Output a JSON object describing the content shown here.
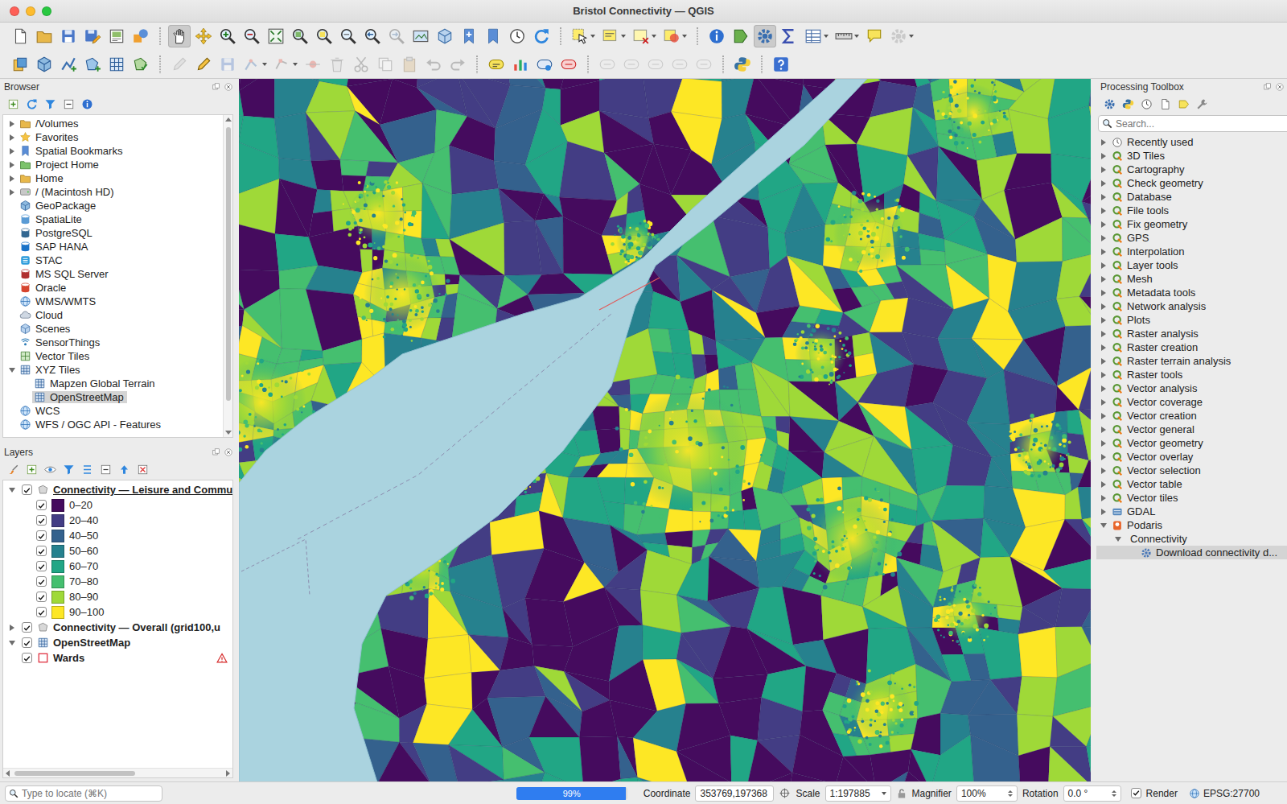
{
  "window": {
    "title": "Bristol Connectivity — QGIS"
  },
  "toolbars": [
    [
      {
        "kind": "button",
        "pressed": false,
        "disabled": false
      },
      {
        "kind": "button",
        "pressed": false,
        "disabled": false
      },
      {
        "kind": "button",
        "pressed": false,
        "disabled": false
      },
      {
        "kind": "button",
        "pressed": false,
        "disabled": false
      },
      {
        "kind": "button",
        "pressed": false,
        "disabled": false
      },
      {
        "kind": "button",
        "pressed": false,
        "disabled": false
      },
      {
        "kind": "separator"
      },
      {
        "kind": "button",
        "pressed": true,
        "disabled": false
      },
      {
        "kind": "button",
        "pressed": false,
        "disabled": false
      },
      {
        "kind": "button",
        "pressed": false,
        "disabled": false
      },
      {
        "kind": "button",
        "pressed": false,
        "disabled": false
      },
      {
        "kind": "button",
        "pressed": false,
        "disabled": false
      },
      {
        "kind": "button",
        "pressed": false,
        "disabled": false
      },
      {
        "kind": "button",
        "pressed": false,
        "disabled": false
      },
      {
        "kind": "button",
        "pressed": false,
        "disabled": false
      },
      {
        "kind": "button",
        "pressed": false,
        "disabled": false
      },
      {
        "kind": "button",
        "pressed": false,
        "disabled": true
      },
      {
        "kind": "button",
        "pressed": false,
        "disabled": false
      },
      {
        "kind": "button",
        "pressed": false,
        "disabled": false
      },
      {
        "kind": "button",
        "pressed": false,
        "disabled": false
      },
      {
        "kind": "button",
        "pressed": false,
        "disabled": false
      },
      {
        "kind": "button",
        "pressed": false,
        "disabled": false
      },
      {
        "kind": "button",
        "pressed": false,
        "disabled": false
      },
      {
        "kind": "separator"
      },
      {
        "kind": "menu",
        "pressed": false,
        "disabled": false
      },
      {
        "kind": "menu",
        "pressed": false,
        "disabled": false
      },
      {
        "kind": "menu",
        "pressed": false,
        "disabled": false
      },
      {
        "kind": "menu",
        "pressed": false,
        "disabled": false
      },
      {
        "kind": "separator"
      },
      {
        "kind": "button",
        "pressed": false,
        "disabled": false
      },
      {
        "kind": "button",
        "pressed": false,
        "disabled": false
      },
      {
        "kind": "button",
        "pressed": true,
        "disabled": false
      },
      {
        "kind": "button",
        "pressed": false,
        "disabled": false
      },
      {
        "kind": "menu",
        "pressed": false,
        "disabled": false
      },
      {
        "kind": "menu",
        "pressed": false,
        "disabled": false
      },
      {
        "kind": "button",
        "pressed": false,
        "disabled": false
      },
      {
        "kind": "menu",
        "pressed": false,
        "disabled": true
      }
    ],
    [
      {
        "kind": "button",
        "pressed": false,
        "disabled": false
      },
      {
        "kind": "button",
        "pressed": false,
        "disabled": false
      },
      {
        "kind": "button",
        "pressed": false,
        "disabled": false
      },
      {
        "kind": "button",
        "pressed": false,
        "disabled": false
      },
      {
        "kind": "button",
        "pressed": false,
        "disabled": false
      },
      {
        "kind": "button",
        "pressed": false,
        "disabled": false
      },
      {
        "kind": "separator"
      },
      {
        "kind": "button",
        "pressed": false,
        "disabled": true
      },
      {
        "kind": "button",
        "pressed": false,
        "disabled": false
      },
      {
        "kind": "button",
        "pressed": false,
        "disabled": true
      },
      {
        "kind": "menu",
        "pressed": false,
        "disabled": true
      },
      {
        "kind": "menu",
        "pressed": false,
        "disabled": true
      },
      {
        "kind": "button",
        "pressed": false,
        "disabled": true
      },
      {
        "kind": "button",
        "pressed": false,
        "disabled": true
      },
      {
        "kind": "button",
        "pressed": false,
        "disabled": true
      },
      {
        "kind": "button",
        "pressed": false,
        "disabled": true
      },
      {
        "kind": "button",
        "pressed": false,
        "disabled": true
      },
      {
        "kind": "button",
        "pressed": false,
        "disabled": true
      },
      {
        "kind": "button",
        "pressed": false,
        "disabled": true
      },
      {
        "kind": "separator"
      },
      {
        "kind": "button",
        "pressed": false,
        "disabled": false
      },
      {
        "kind": "button",
        "pressed": false,
        "disabled": false
      },
      {
        "kind": "button",
        "pressed": false,
        "disabled": false
      },
      {
        "kind": "button",
        "pressed": false,
        "disabled": false
      },
      {
        "kind": "separator"
      },
      {
        "kind": "button",
        "pressed": false,
        "disabled": true
      },
      {
        "kind": "button",
        "pressed": false,
        "disabled": true
      },
      {
        "kind": "button",
        "pressed": false,
        "disabled": true
      },
      {
        "kind": "button",
        "pressed": false,
        "disabled": true
      },
      {
        "kind": "button",
        "pressed": false,
        "disabled": true
      },
      {
        "kind": "separator"
      },
      {
        "kind": "button",
        "pressed": false,
        "disabled": false
      },
      {
        "kind": "separator"
      },
      {
        "kind": "button",
        "pressed": false,
        "disabled": false
      }
    ]
  ],
  "browser": {
    "title": "Browser",
    "items": [
      {
        "label": "/Volumes",
        "depth": 0,
        "expandable": true,
        "expanded": false,
        "selected": false
      },
      {
        "label": "Favorites",
        "depth": 0,
        "expandable": true,
        "expanded": false,
        "selected": false
      },
      {
        "label": "Spatial Bookmarks",
        "depth": 0,
        "expandable": true,
        "expanded": false,
        "selected": false
      },
      {
        "label": "Project Home",
        "depth": 0,
        "expandable": true,
        "expanded": false,
        "selected": false
      },
      {
        "label": "Home",
        "depth": 0,
        "expandable": true,
        "expanded": false,
        "selected": false
      },
      {
        "label": "/ (Macintosh HD)",
        "depth": 0,
        "expandable": true,
        "expanded": false,
        "selected": false
      },
      {
        "label": "GeoPackage",
        "depth": 0,
        "expandable": false,
        "expanded": false,
        "selected": false
      },
      {
        "label": "SpatiaLite",
        "depth": 0,
        "expandable": false,
        "expanded": false,
        "selected": false
      },
      {
        "label": "PostgreSQL",
        "depth": 0,
        "expandable": false,
        "expanded": false,
        "selected": false
      },
      {
        "label": "SAP HANA",
        "depth": 0,
        "expandable": false,
        "expanded": false,
        "selected": false
      },
      {
        "label": "STAC",
        "depth": 0,
        "expandable": false,
        "expanded": false,
        "selected": false
      },
      {
        "label": "MS SQL Server",
        "depth": 0,
        "expandable": false,
        "expanded": false,
        "selected": false
      },
      {
        "label": "Oracle",
        "depth": 0,
        "expandable": false,
        "expanded": false,
        "selected": false
      },
      {
        "label": "WMS/WMTS",
        "depth": 0,
        "expandable": false,
        "expanded": false,
        "selected": false
      },
      {
        "label": "Cloud",
        "depth": 0,
        "expandable": false,
        "expanded": false,
        "selected": false
      },
      {
        "label": "Scenes",
        "depth": 0,
        "expandable": false,
        "expanded": false,
        "selected": false
      },
      {
        "label": "SensorThings",
        "depth": 0,
        "expandable": false,
        "expanded": false,
        "selected": false
      },
      {
        "label": "Vector Tiles",
        "depth": 0,
        "expandable": false,
        "expanded": false,
        "selected": false
      },
      {
        "label": "XYZ Tiles",
        "depth": 0,
        "expandable": true,
        "expanded": true,
        "selected": false
      },
      {
        "label": "Mapzen Global Terrain",
        "depth": 1,
        "expandable": false,
        "expanded": false,
        "selected": false
      },
      {
        "label": "OpenStreetMap",
        "depth": 1,
        "expandable": false,
        "expanded": false,
        "selected": true
      },
      {
        "label": "WCS",
        "depth": 0,
        "expandable": false,
        "expanded": false,
        "selected": false
      },
      {
        "label": "WFS / OGC API - Features",
        "depth": 0,
        "expandable": false,
        "expanded": false,
        "selected": false
      }
    ]
  },
  "layers": {
    "title": "Layers",
    "items": [
      {
        "label": "Connectivity — Leisure and Commu",
        "kind": "vector",
        "expandable": true,
        "expanded": true,
        "checked": true,
        "current": true,
        "warning": false,
        "classes": [
          {
            "label": "0–20",
            "checked": true,
            "color": "#450b5e"
          },
          {
            "label": "20–40",
            "checked": true,
            "color": "#433d84"
          },
          {
            "label": "40–50",
            "checked": true,
            "color": "#34618d"
          },
          {
            "label": "50–60",
            "checked": true,
            "color": "#26818e"
          },
          {
            "label": "60–70",
            "checked": true,
            "color": "#21a685"
          },
          {
            "label": "70–80",
            "checked": true,
            "color": "#45bf6f"
          },
          {
            "label": "80–90",
            "checked": true,
            "color": "#9fd938"
          },
          {
            "label": "90–100",
            "checked": true,
            "color": "#fde725"
          }
        ]
      },
      {
        "label": "Connectivity — Overall (grid100,u",
        "kind": "vector",
        "expandable": true,
        "expanded": false,
        "checked": true,
        "current": false,
        "warning": false,
        "classes": []
      },
      {
        "label": "OpenStreetMap",
        "kind": "raster",
        "expandable": true,
        "expanded": true,
        "checked": true,
        "current": false,
        "warning": false,
        "classes": []
      },
      {
        "label": "Wards",
        "kind": "outline",
        "expandable": false,
        "expanded": false,
        "checked": true,
        "current": false,
        "warning": true,
        "classes": []
      }
    ]
  },
  "toolbox": {
    "title": "Processing Toolbox",
    "search": {
      "placeholder": "Search..."
    },
    "items": [
      {
        "label": "Recently used",
        "kind": "recent",
        "depth": 0,
        "expanded": false,
        "selected": false
      },
      {
        "label": "3D Tiles",
        "kind": "qgis",
        "depth": 0,
        "expanded": false,
        "selected": false
      },
      {
        "label": "Cartography",
        "kind": "qgis",
        "depth": 0,
        "expanded": false,
        "selected": false
      },
      {
        "label": "Check geometry",
        "kind": "qgis",
        "depth": 0,
        "expanded": false,
        "selected": false
      },
      {
        "label": "Database",
        "kind": "qgis",
        "depth": 0,
        "expanded": false,
        "selected": false
      },
      {
        "label": "File tools",
        "kind": "qgis",
        "depth": 0,
        "expanded": false,
        "selected": false
      },
      {
        "label": "Fix geometry",
        "kind": "qgis",
        "depth": 0,
        "expanded": false,
        "selected": false
      },
      {
        "label": "GPS",
        "kind": "qgis",
        "depth": 0,
        "expanded": false,
        "selected": false
      },
      {
        "label": "Interpolation",
        "kind": "qgis",
        "depth": 0,
        "expanded": false,
        "selected": false
      },
      {
        "label": "Layer tools",
        "kind": "qgis",
        "depth": 0,
        "expanded": false,
        "selected": false
      },
      {
        "label": "Mesh",
        "kind": "qgis",
        "depth": 0,
        "expanded": false,
        "selected": false
      },
      {
        "label": "Metadata tools",
        "kind": "qgis",
        "depth": 0,
        "expanded": false,
        "selected": false
      },
      {
        "label": "Network analysis",
        "kind": "qgis",
        "depth": 0,
        "expanded": false,
        "selected": false
      },
      {
        "label": "Plots",
        "kind": "qgis",
        "depth": 0,
        "expanded": false,
        "selected": false
      },
      {
        "label": "Raster analysis",
        "kind": "qgis",
        "depth": 0,
        "expanded": false,
        "selected": false
      },
      {
        "label": "Raster creation",
        "kind": "qgis",
        "depth": 0,
        "expanded": false,
        "selected": false
      },
      {
        "label": "Raster terrain analysis",
        "kind": "qgis",
        "depth": 0,
        "expanded": false,
        "selected": false
      },
      {
        "label": "Raster tools",
        "kind": "qgis",
        "depth": 0,
        "expanded": false,
        "selected": false
      },
      {
        "label": "Vector analysis",
        "kind": "qgis",
        "depth": 0,
        "expanded": false,
        "selected": false
      },
      {
        "label": "Vector coverage",
        "kind": "qgis",
        "depth": 0,
        "expanded": false,
        "selected": false
      },
      {
        "label": "Vector creation",
        "kind": "qgis",
        "depth": 0,
        "expanded": false,
        "selected": false
      },
      {
        "label": "Vector general",
        "kind": "qgis",
        "depth": 0,
        "expanded": false,
        "selected": false
      },
      {
        "label": "Vector geometry",
        "kind": "qgis",
        "depth": 0,
        "expanded": false,
        "selected": false
      },
      {
        "label": "Vector overlay",
        "kind": "qgis",
        "depth": 0,
        "expanded": false,
        "selected": false
      },
      {
        "label": "Vector selection",
        "kind": "qgis",
        "depth": 0,
        "expanded": false,
        "selected": false
      },
      {
        "label": "Vector table",
        "kind": "qgis",
        "depth": 0,
        "expanded": false,
        "selected": false
      },
      {
        "label": "Vector tiles",
        "kind": "qgis",
        "depth": 0,
        "expanded": false,
        "selected": false
      },
      {
        "label": "GDAL",
        "kind": "gdal",
        "depth": 0,
        "expanded": false,
        "selected": false
      },
      {
        "label": "Podaris",
        "kind": "podaris",
        "depth": 0,
        "expanded": true,
        "selected": false
      },
      {
        "label": "Connectivity",
        "kind": "group",
        "depth": 1,
        "expanded": true,
        "selected": false
      },
      {
        "label": "Download connectivity d...",
        "kind": "algorithm",
        "depth": 2,
        "expanded": false,
        "selected": true
      }
    ]
  },
  "status_bar": {
    "locator": {
      "placeholder": "Type to locate (⌘K)"
    },
    "progress": {
      "level": 0.99,
      "reading": "99%"
    },
    "coordinate": {
      "label": "Coordinate",
      "value": "353769,197368"
    },
    "scale": {
      "label": "Scale",
      "value": "1:197885",
      "locked": false
    },
    "magnifier": {
      "label": "Magnifier",
      "value": "100%"
    },
    "rotation": {
      "label": "Rotation",
      "value": "0.0 °"
    },
    "render": {
      "label": "Render",
      "checked": true
    },
    "crs": "EPSG:27700"
  }
}
